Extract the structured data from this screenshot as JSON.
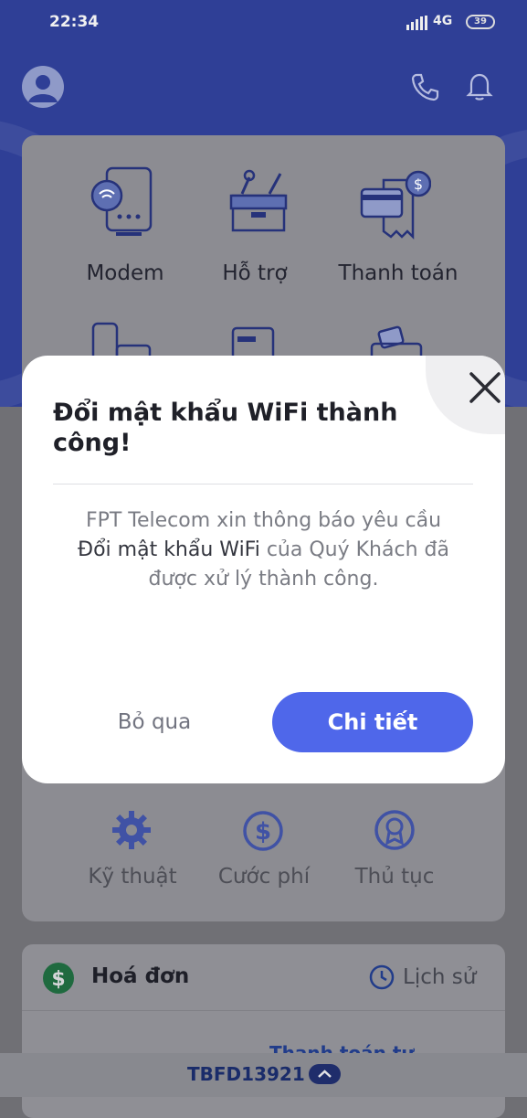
{
  "status_bar": {
    "time": "22:34",
    "network": "4G",
    "battery": "39"
  },
  "header": {
    "icons": [
      "user-avatar-icon",
      "phone-icon",
      "bell-icon"
    ]
  },
  "quick_actions": {
    "row1": [
      {
        "label": "Modem",
        "icon": "modem-icon"
      },
      {
        "label": "Hỗ trợ",
        "icon": "support-toolbox-icon"
      },
      {
        "label": "Thanh toán",
        "icon": "payment-card-icon"
      }
    ],
    "row2_icons": [
      "device-icon",
      "document-icon",
      "wallet-icon"
    ]
  },
  "bottom_actions": [
    {
      "label": "Kỹ thuật",
      "icon": "gear-icon"
    },
    {
      "label": "Cước phí",
      "icon": "dollar-icon"
    },
    {
      "label": "Thủ tục",
      "icon": "badge-icon"
    }
  ],
  "invoice": {
    "title": "Hoá đơn",
    "history_label": "Lịch sử",
    "pay_link": "Thanh toán tự",
    "dollar_color": "#1f8f4e"
  },
  "account": {
    "id": "TBFD13921"
  },
  "modal": {
    "title": "Đổi mật khẩu WiFi thành công!",
    "message_pre": "FPT Telecom xin thông báo yêu cầu",
    "message_strong": "Đổi mật khẩu WiFi",
    "message_mid": " của Quý Khách đã",
    "message_post": "được xử lý thành công.",
    "skip_label": "Bỏ qua",
    "detail_label": "Chi tiết",
    "accent": "#4f67ea"
  }
}
